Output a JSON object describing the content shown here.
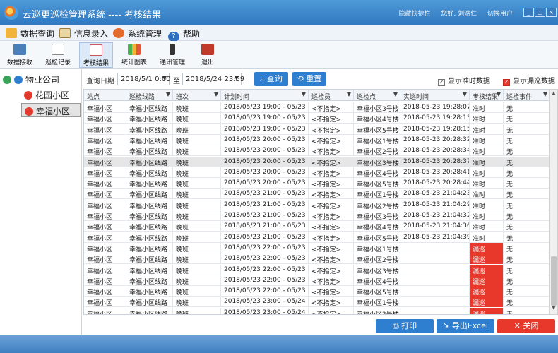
{
  "window": {
    "title": "云巡更巡检管理系统 ---- 考核结果",
    "links": [
      "隐藏快捷栏",
      "您好, 刘浩仁",
      "切换用户"
    ],
    "controls": [
      "_",
      "□",
      "×"
    ]
  },
  "menu": [
    {
      "label": "数据查询",
      "icon": "data-query-icon"
    },
    {
      "label": "信息录入",
      "icon": "info-entry-icon"
    },
    {
      "label": "系统管理",
      "icon": "gear-icon"
    },
    {
      "label": "帮助",
      "icon": "help-icon"
    }
  ],
  "toolbar": [
    {
      "label": "数据接收",
      "icon": "data-receive-icon"
    },
    {
      "label": "巡检记录",
      "icon": "inspection-record-icon"
    },
    {
      "label": "考核结果",
      "icon": "assessment-result-icon",
      "active": true
    },
    {
      "label": "统计图表",
      "icon": "bar-chart-icon"
    },
    {
      "label": "通讯管理",
      "icon": "pen-device-icon"
    },
    {
      "label": "退出",
      "icon": "exit-icon"
    }
  ],
  "tree": {
    "root": "物业公司",
    "children": [
      "花园小区",
      "幸福小区"
    ],
    "selected": "幸福小区"
  },
  "query": {
    "date_label": "查询日期",
    "start": "2018/5/1 0:00",
    "sep": "至",
    "end": "2018/5/24 23:59",
    "search_label": "查询",
    "reset_label": "重置",
    "show_ontime_label": "显示准时数据",
    "show_missed_label": "显示漏巡数据"
  },
  "grid": {
    "columns": [
      "站点",
      "巡检线路",
      "班次",
      "计划时间",
      "巡检员",
      "巡检点",
      "实巡时间",
      "考核结果",
      "巡检事件"
    ],
    "rows": [
      [
        "幸福小区",
        "幸福小区线路",
        "晚班",
        "2018/05/23 19:00 - 05/23 20:00",
        "<不指定>",
        "幸福小区3号楼",
        "2018-05-23 19:28:07",
        "准时",
        "无"
      ],
      [
        "幸福小区",
        "幸福小区线路",
        "晚班",
        "2018/05/23 19:00 - 05/23 20:00",
        "<不指定>",
        "幸福小区4号楼",
        "2018-05-23 19:28:13",
        "准时",
        "无"
      ],
      [
        "幸福小区",
        "幸福小区线路",
        "晚班",
        "2018/05/23 19:00 - 05/23 20:00",
        "<不指定>",
        "幸福小区5号楼",
        "2018-05-23 19:28:15",
        "准时",
        "无"
      ],
      [
        "幸福小区",
        "幸福小区线路",
        "晚班",
        "2018/05/23 20:00 - 05/23 21:00",
        "<不指定>",
        "幸福小区1号楼",
        "2018-05-23 20:28:32",
        "准时",
        "无"
      ],
      [
        "幸福小区",
        "幸福小区线路",
        "晚班",
        "2018/05/23 20:00 - 05/23 21:00",
        "<不指定>",
        "幸福小区2号楼",
        "2018-05-23 20:28:34",
        "准时",
        "无"
      ],
      [
        "幸福小区",
        "幸福小区线路",
        "晚班",
        "2018/05/23 20:00 - 05/23 21:00",
        "<不指定>",
        "幸福小区3号楼",
        "2018-05-23 20:28:37",
        "准时",
        "无"
      ],
      [
        "幸福小区",
        "幸福小区线路",
        "晚班",
        "2018/05/23 20:00 - 05/23 21:00",
        "<不指定>",
        "幸福小区4号楼",
        "2018-05-23 20:28:41",
        "准时",
        "无"
      ],
      [
        "幸福小区",
        "幸福小区线路",
        "晚班",
        "2018/05/23 20:00 - 05/23 21:00",
        "<不指定>",
        "幸福小区5号楼",
        "2018-05-23 20:28:44",
        "准时",
        "无"
      ],
      [
        "幸福小区",
        "幸福小区线路",
        "晚班",
        "2018/05/23 21:00 - 05/23 22:00",
        "<不指定>",
        "幸福小区1号楼",
        "2018-05-23 21:04:23",
        "准时",
        "无"
      ],
      [
        "幸福小区",
        "幸福小区线路",
        "晚班",
        "2018/05/23 21:00 - 05/23 22:00",
        "<不指定>",
        "幸福小区2号楼",
        "2018-05-23 21:04:29",
        "准时",
        "无"
      ],
      [
        "幸福小区",
        "幸福小区线路",
        "晚班",
        "2018/05/23 21:00 - 05/23 22:00",
        "<不指定>",
        "幸福小区3号楼",
        "2018-05-23 21:04:32",
        "准时",
        "无"
      ],
      [
        "幸福小区",
        "幸福小区线路",
        "晚班",
        "2018/05/23 21:00 - 05/23 22:00",
        "<不指定>",
        "幸福小区4号楼",
        "2018-05-23 21:04:36",
        "准时",
        "无"
      ],
      [
        "幸福小区",
        "幸福小区线路",
        "晚班",
        "2018/05/23 21:00 - 05/23 22:00",
        "<不指定>",
        "幸福小区5号楼",
        "2018-05-23 21:04:39",
        "准时",
        "无"
      ],
      [
        "幸福小区",
        "幸福小区线路",
        "晚班",
        "2018/05/23 22:00 - 05/23 23:00",
        "<不指定>",
        "幸福小区1号楼",
        "",
        "漏巡",
        "无"
      ],
      [
        "幸福小区",
        "幸福小区线路",
        "晚班",
        "2018/05/23 22:00 - 05/23 23:00",
        "<不指定>",
        "幸福小区2号楼",
        "",
        "漏巡",
        "无"
      ],
      [
        "幸福小区",
        "幸福小区线路",
        "晚班",
        "2018/05/23 22:00 - 05/23 23:00",
        "<不指定>",
        "幸福小区3号楼",
        "",
        "漏巡",
        "无"
      ],
      [
        "幸福小区",
        "幸福小区线路",
        "晚班",
        "2018/05/23 22:00 - 05/23 23:00",
        "<不指定>",
        "幸福小区4号楼",
        "",
        "漏巡",
        "无"
      ],
      [
        "幸福小区",
        "幸福小区线路",
        "晚班",
        "2018/05/23 22:00 - 05/23 23:00",
        "<不指定>",
        "幸福小区5号楼",
        "",
        "漏巡",
        "无"
      ],
      [
        "幸福小区",
        "幸福小区线路",
        "晚班",
        "2018/05/23 23:00 - 05/24 00:00",
        "<不指定>",
        "幸福小区1号楼",
        "",
        "漏巡",
        "无"
      ],
      [
        "幸福小区",
        "幸福小区线路",
        "晚班",
        "2018/05/23 23:00 - 05/24 00:00",
        "<不指定>",
        "幸福小区2号楼",
        "",
        "漏巡",
        "无"
      ]
    ],
    "selected_row": 5
  },
  "actions": {
    "print": "打印",
    "export": "导出Excel",
    "close": "关闭"
  },
  "colors": {
    "primary": "#2f7fd1",
    "danger": "#e8382c",
    "titlebar": "#3a86cf"
  }
}
